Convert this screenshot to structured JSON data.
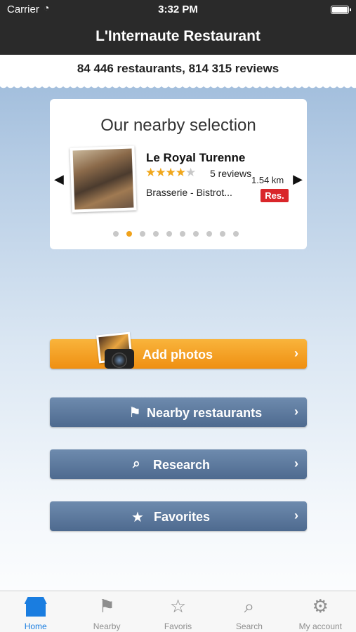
{
  "status": {
    "carrier": "Carrier",
    "time": "3:32 PM"
  },
  "nav": {
    "title": "L'Internaute Restaurant"
  },
  "stats": {
    "text": "84 446 restaurants,  814 315 reviews"
  },
  "nearby": {
    "heading": "Our nearby selection",
    "restaurant": {
      "name": "Le Royal Turenne",
      "rating": 4,
      "rating_max": 5,
      "reviews": "5 reviews",
      "distance": "1.54 km",
      "category": "Brasserie - Bistrot...",
      "reservation_badge": "Res."
    },
    "page_count": 10,
    "current_page": 2
  },
  "buttons": {
    "add_photos": "Add photos",
    "nearby_restaurants": "Nearby restaurants",
    "research": "Research",
    "favorites": "Favorites"
  },
  "tabs": [
    {
      "label": "Home",
      "icon": "home-icon",
      "active": true
    },
    {
      "label": "Nearby",
      "icon": "signpost-icon",
      "active": false
    },
    {
      "label": "Favoris",
      "icon": "star-icon",
      "active": false
    },
    {
      "label": "Search",
      "icon": "search-icon",
      "active": false
    },
    {
      "label": "My account",
      "icon": "gears-icon",
      "active": false
    }
  ],
  "colors": {
    "accent": "#1a7de0",
    "orange_button": "#f39b1e",
    "blue_button": "#5a769a",
    "reservation": "#d9262a",
    "star": "#f0a71c"
  }
}
